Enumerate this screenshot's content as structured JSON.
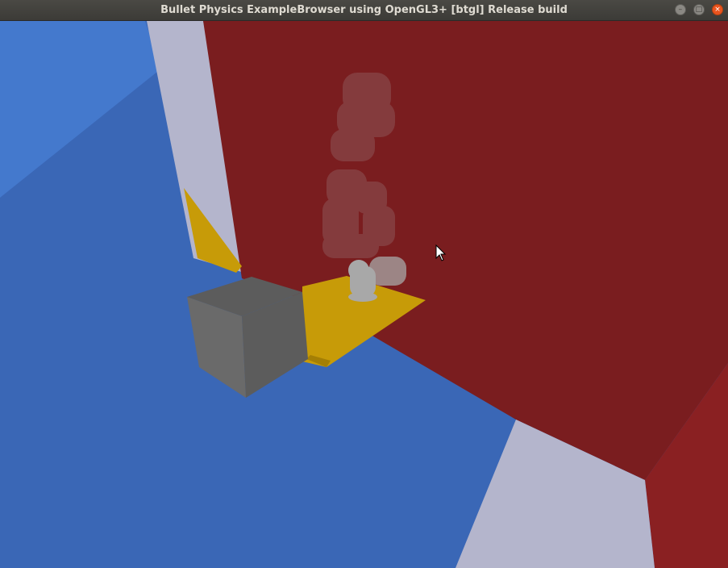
{
  "window": {
    "title": "Bullet Physics ExampleBrowser using OpenGL3+ [btgl] Release build",
    "controls": {
      "minimize_icon": "minimize-icon",
      "maximize_icon": "maximize-icon",
      "close_icon": "close-icon"
    }
  },
  "scene": {
    "colors": {
      "floor": "#3a67b6",
      "floor_light": "#4479cd",
      "red_wall": "#7a1d1f",
      "red_wall_right": "#8a2022",
      "white_panel": "#b4b5cc",
      "yellow": "#c79b08",
      "yellow_dark": "#a47f05",
      "gray_cube_front": "#6a6a6a",
      "gray_cube_top": "#5c5c5c",
      "robot": "#a8a8a8"
    },
    "cursor": "mouse-pointer-icon"
  }
}
